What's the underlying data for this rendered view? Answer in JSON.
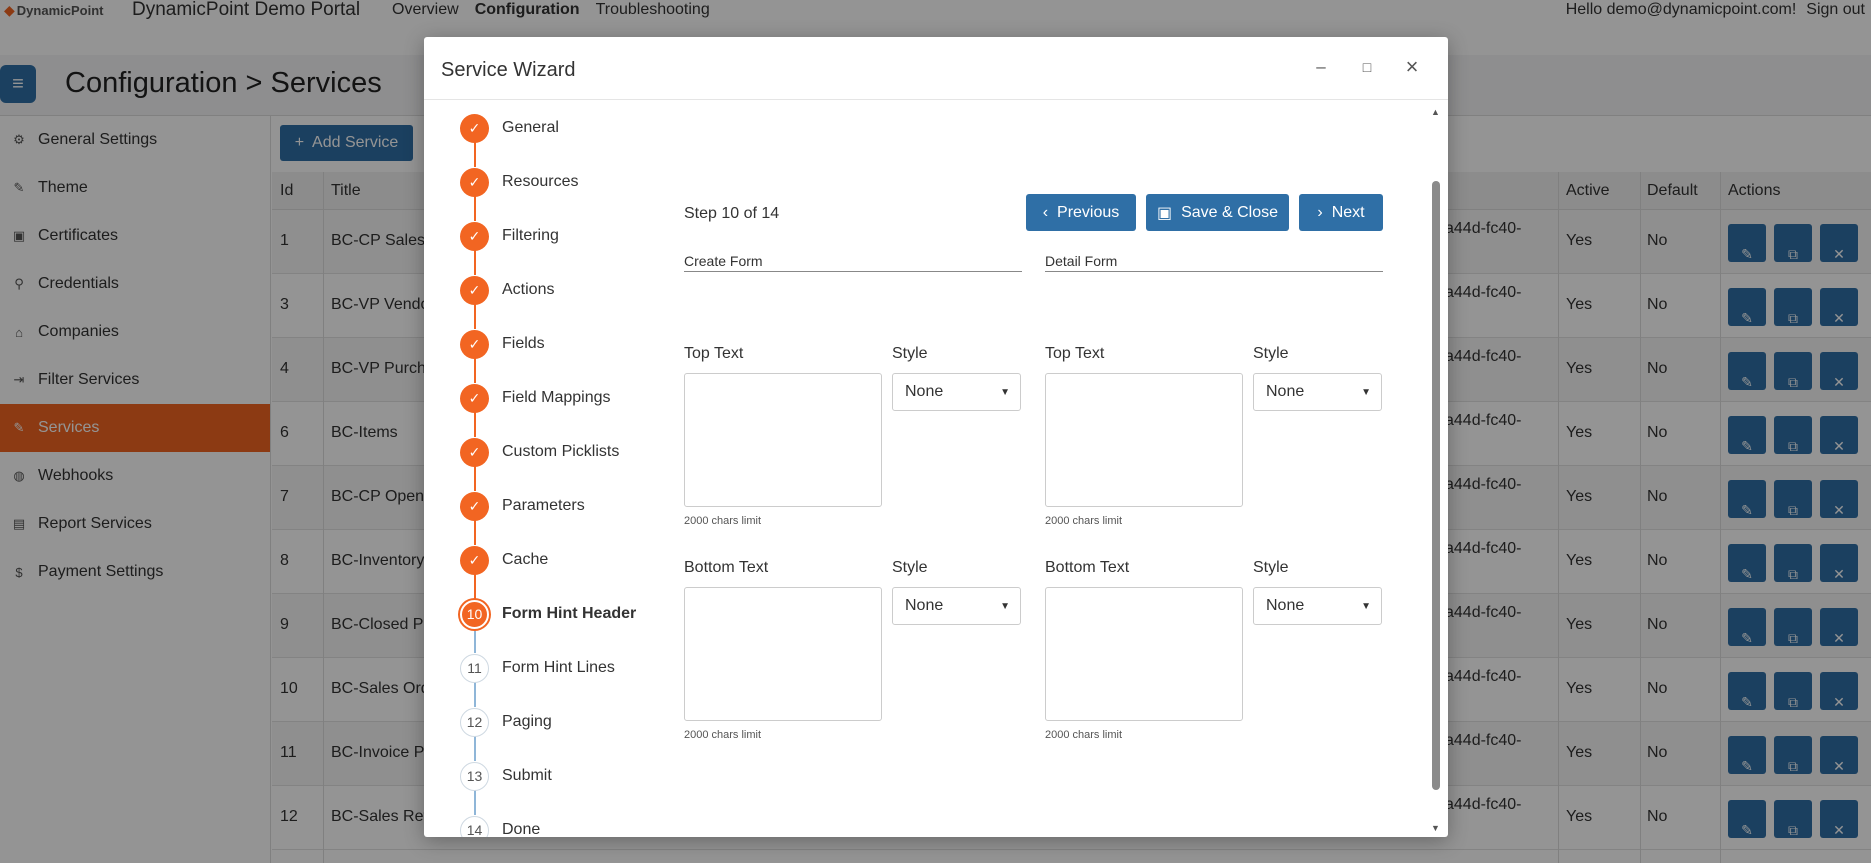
{
  "topbar": {
    "logo_text": "DynamicPoint",
    "logo_accent": "Point",
    "app_title": "DynamicPoint Demo Portal",
    "nav": [
      "Overview",
      "Configuration",
      "Troubleshooting"
    ],
    "greeting": "Hello demo@dynamicpoint.com!",
    "sign_out": "Sign out"
  },
  "page": {
    "title": "Configuration > Services"
  },
  "sidebar": {
    "items": [
      {
        "label": "General Settings",
        "icon": "gear-icon"
      },
      {
        "label": "Theme",
        "icon": "brush-icon"
      },
      {
        "label": "Certificates",
        "icon": "certificate-icon"
      },
      {
        "label": "Credentials",
        "icon": "key-icon"
      },
      {
        "label": "Companies",
        "icon": "home-icon"
      },
      {
        "label": "Filter Services",
        "icon": "filter-icon"
      },
      {
        "label": "Services",
        "icon": "wrench-icon"
      },
      {
        "label": "Webhooks",
        "icon": "globe-icon"
      },
      {
        "label": "Report Services",
        "icon": "report-icon"
      },
      {
        "label": "Payment Settings",
        "icon": "dollar-icon"
      }
    ]
  },
  "main": {
    "add_button": "Add Service",
    "columns": {
      "id": "Id",
      "title": "Title",
      "active": "Active",
      "default": "Default",
      "actions": "Actions"
    },
    "rows": [
      {
        "id": "1",
        "title": "BC-CP Sales C",
        "guid": "a44d-fc40-",
        "active": "Yes",
        "default": "No"
      },
      {
        "id": "3",
        "title": "BC-VP Vendo",
        "guid": "a44d-fc40-",
        "active": "Yes",
        "default": "No"
      },
      {
        "id": "4",
        "title": "BC-VP Purcha",
        "guid": "a44d-fc40-",
        "active": "Yes",
        "default": "No"
      },
      {
        "id": "6",
        "title": "BC-Items",
        "guid": "a44d-fc40-",
        "active": "Yes",
        "default": "No"
      },
      {
        "id": "7",
        "title": "BC-CP Open",
        "guid": "a44d-fc40-",
        "active": "Yes",
        "default": "No"
      },
      {
        "id": "8",
        "title": "BC-Inventory",
        "guid": "a44d-fc40-",
        "active": "Yes",
        "default": "No"
      },
      {
        "id": "9",
        "title": "BC-Closed Pu",
        "guid": "a44d-fc40-",
        "active": "Yes",
        "default": "No"
      },
      {
        "id": "10",
        "title": "BC-Sales Ord",
        "guid": "a44d-fc40-",
        "active": "Yes",
        "default": "No"
      },
      {
        "id": "11",
        "title": "BC-Invoice Pa",
        "guid": "a44d-fc40-",
        "active": "Yes",
        "default": "No"
      },
      {
        "id": "12",
        "title": "BC-Sales Retu",
        "guid": "a44d-fc40-",
        "active": "Yes",
        "default": "No"
      }
    ]
  },
  "modal": {
    "title": "Service Wizard",
    "controls": {
      "minimize": "–",
      "maximize": "□",
      "close": "×"
    },
    "steps": [
      {
        "num": "1",
        "label": "General",
        "state": "done"
      },
      {
        "num": "2",
        "label": "Resources",
        "state": "done"
      },
      {
        "num": "3",
        "label": "Filtering",
        "state": "done"
      },
      {
        "num": "4",
        "label": "Actions",
        "state": "done"
      },
      {
        "num": "5",
        "label": "Fields",
        "state": "done"
      },
      {
        "num": "6",
        "label": "Field Mappings",
        "state": "done"
      },
      {
        "num": "7",
        "label": "Custom Picklists",
        "state": "done"
      },
      {
        "num": "8",
        "label": "Parameters",
        "state": "done"
      },
      {
        "num": "9",
        "label": "Cache",
        "state": "done"
      },
      {
        "num": "10",
        "label": "Form Hint Header",
        "state": "current"
      },
      {
        "num": "11",
        "label": "Form Hint Lines",
        "state": "todo"
      },
      {
        "num": "12",
        "label": "Paging",
        "state": "todo"
      },
      {
        "num": "13",
        "label": "Submit",
        "state": "todo"
      },
      {
        "num": "14",
        "label": "Done",
        "state": "todo"
      }
    ],
    "step_counter": "Step 10 of 14",
    "buttons": {
      "previous": "Previous",
      "save_close": "Save & Close",
      "next": "Next"
    },
    "create_form": {
      "heading": "Create Form",
      "top_text_label": "Top Text",
      "top_style_label": "Style",
      "top_style_value": "None",
      "top_hint": "2000 chars limit",
      "bottom_text_label": "Bottom Text",
      "bottom_style_label": "Style",
      "bottom_style_value": "None",
      "bottom_hint": "2000 chars limit"
    },
    "detail_form": {
      "heading": "Detail Form",
      "top_text_label": "Top Text",
      "top_style_label": "Style",
      "top_style_value": "None",
      "top_hint": "2000 chars limit",
      "bottom_text_label": "Bottom Text",
      "bottom_style_label": "Style",
      "bottom_style_value": "None",
      "bottom_hint": "2000 chars limit"
    }
  },
  "colors": {
    "accent": "#f26522",
    "primary": "#2f6fa6",
    "step_line_todo": "#8fb6d8"
  }
}
